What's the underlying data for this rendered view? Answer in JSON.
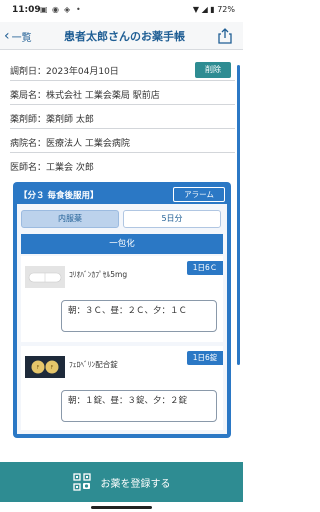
{
  "status_bar": {
    "time": "11:09",
    "battery": "72%"
  },
  "titlebar": {
    "back_label": "一覧",
    "title": "患者太郎さんのお薬手帳"
  },
  "info": {
    "date": "調剤日：2023年04月10日",
    "delete_label": "削除",
    "pharmacy": "薬局名：株式会社 工業会薬局 駅前店",
    "pharmacist": "薬剤師：薬剤師 太郎",
    "hospital": "病院名：医療法人 工業会病院",
    "doctor": "医師名：工業会 次郎"
  },
  "prescription": {
    "header": "【分３ 毎食後服用】",
    "alarm_label": "アラーム",
    "category": "内服薬",
    "days": "5日分",
    "group_label": "一包化",
    "drugs": [
      {
        "name": "ｺﾘｵﾊﾞﾝｶﾌﾟｾﾙ5mg",
        "dose": "1日6Ｃ",
        "timing": "朝：３Ｃ、昼：２Ｃ、夕：１Ｃ"
      },
      {
        "name": "ﾌｪﾛﾍﾞﾘﾝ配合錠",
        "dose": "1日6錠",
        "timing": "朝：１錠、昼：３錠、夕：２錠"
      }
    ]
  },
  "register_label": "お薬を登録する",
  "colors": {
    "primary_blue": "#2b78c5",
    "teal": "#2e8c92",
    "title_blue": "#1f5e94"
  }
}
